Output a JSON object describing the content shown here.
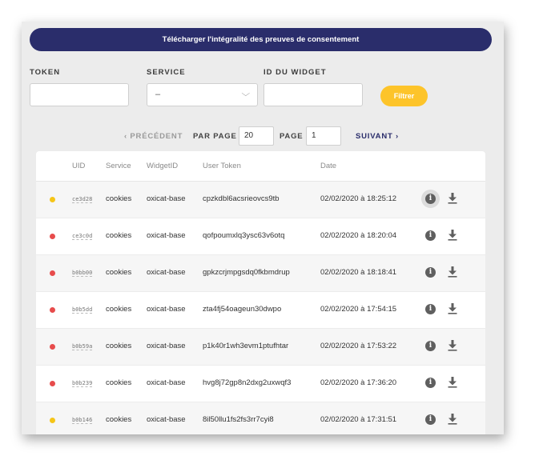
{
  "header": {
    "download_all_label": "Télécharger l'intégralité des preuves de consentement"
  },
  "filters": {
    "token_label": "TOKEN",
    "token_value": "",
    "service_label": "SERVICE",
    "service_value": "–",
    "widget_label": "ID DU WIDGET",
    "widget_value": "",
    "filter_button": "Filtrer"
  },
  "pagination": {
    "previous": "‹ PRÉCÉDENT",
    "per_page_label": "PAR PAGE",
    "per_page_value": "20",
    "page_label": "PAGE",
    "page_value": "1",
    "next": "SUIVANT ›"
  },
  "table": {
    "columns": [
      "UID",
      "Service",
      "WidgetID",
      "User Token",
      "Date"
    ],
    "status_colors": {
      "yellow": "#f5c518",
      "red": "#e74c4c"
    },
    "rows": [
      {
        "status": "yellow",
        "uid": "ce3d28",
        "service": "cookies",
        "widget": "oxicat-base",
        "token": "cpzkdbl6acsrieovcs9tb",
        "date": "02/02/2020 à 18:25:12"
      },
      {
        "status": "red",
        "uid": "ce3c0d",
        "service": "cookies",
        "widget": "oxicat-base",
        "token": "qofpoumxlq3ysc63v6otq",
        "date": "02/02/2020 à 18:20:04"
      },
      {
        "status": "red",
        "uid": "b0bb00",
        "service": "cookies",
        "widget": "oxicat-base",
        "token": "gpkzcrjmpgsdq0fkbmdrup",
        "date": "02/02/2020 à 18:18:41"
      },
      {
        "status": "red",
        "uid": "b0b5dd",
        "service": "cookies",
        "widget": "oxicat-base",
        "token": "zta4fj54oageun30dwpo",
        "date": "02/02/2020 à 17:54:15"
      },
      {
        "status": "red",
        "uid": "b0b59a",
        "service": "cookies",
        "widget": "oxicat-base",
        "token": "p1k40r1wh3evm1ptufhtar",
        "date": "02/02/2020 à 17:53:22"
      },
      {
        "status": "red",
        "uid": "b0b239",
        "service": "cookies",
        "widget": "oxicat-base",
        "token": "hvg8j72gp8n2dxg2uxwqf3",
        "date": "02/02/2020 à 17:36:20"
      },
      {
        "status": "yellow",
        "uid": "b0b146",
        "service": "cookies",
        "widget": "oxicat-base",
        "token": "8il50llu1fs2fs3rr7cyi8",
        "date": "02/02/2020 à 17:31:51"
      }
    ],
    "action_icons": [
      "info-icon",
      "download-icon"
    ]
  }
}
